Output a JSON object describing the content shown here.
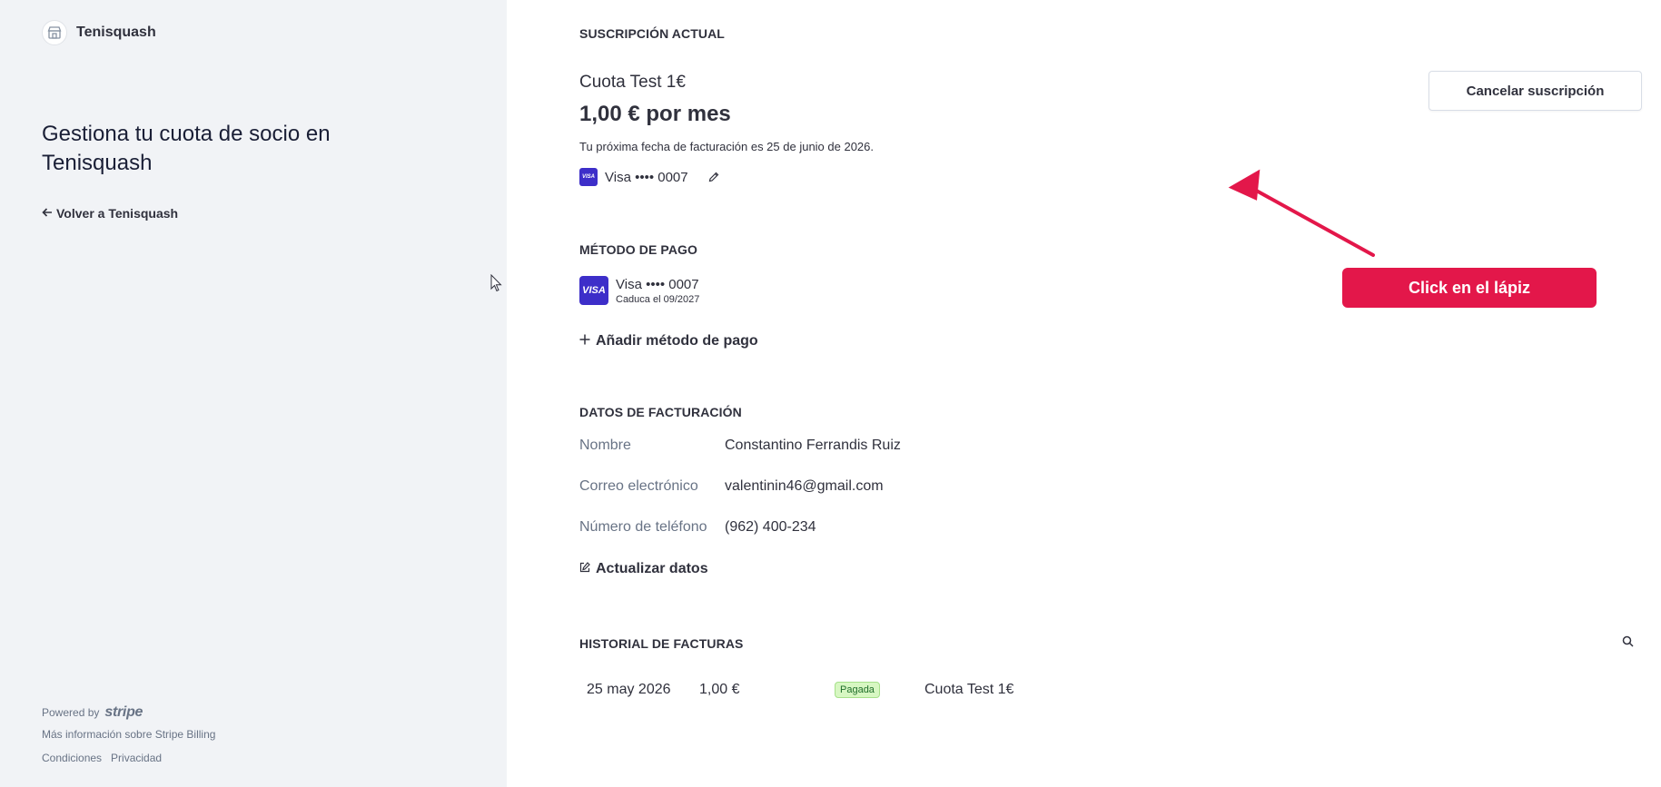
{
  "sidebar": {
    "brand_name": "Tenisquash",
    "heading": "Gestiona tu cuota de socio en Tenisquash",
    "back_link": "Volver a Tenisquash",
    "powered_by": "Powered by",
    "stripe_word": "stripe",
    "learn_more": "Más información sobre Stripe Billing",
    "terms": "Condiciones",
    "privacy": "Privacidad"
  },
  "subscription": {
    "section_title": "SUSCRIPCIÓN ACTUAL",
    "plan_name": "Cuota Test 1€",
    "price": "1,00 € por mes",
    "next_billing": "Tu próxima fecha de facturación es 25 de junio de 2026.",
    "card_label": "Visa •••• 0007",
    "cancel_button": "Cancelar suscripción"
  },
  "payment_method": {
    "section_title": "MÉTODO DE PAGO",
    "card_brand": "VISA",
    "card_label": "Visa •••• 0007",
    "expiry": "Caduca el 09/2027",
    "add_label": "Añadir método de pago"
  },
  "billing_details": {
    "section_title": "DATOS DE FACTURACIÓN",
    "rows": [
      {
        "label": "Nombre",
        "value": "Constantino Ferrandis Ruiz"
      },
      {
        "label": "Correo electrónico",
        "value": "valentinin46@gmail.com"
      },
      {
        "label": "Número de teléfono",
        "value": "(962) 400-234"
      }
    ],
    "update_label": "Actualizar datos"
  },
  "invoices": {
    "section_title": "HISTORIAL DE FACTURAS",
    "rows": [
      {
        "date": "25 may 2026",
        "amount": "1,00 €",
        "status": "Pagada",
        "description": "Cuota Test 1€"
      }
    ]
  },
  "annotation": {
    "callout_text": "Click en el lápiz",
    "color": "#e3174a"
  },
  "colors": {
    "sidebar_bg": "#f1f3f6",
    "visa_brand": "#3d2ec9",
    "badge_bg": "#d7f7c2",
    "badge_text": "#1f6e2a"
  }
}
